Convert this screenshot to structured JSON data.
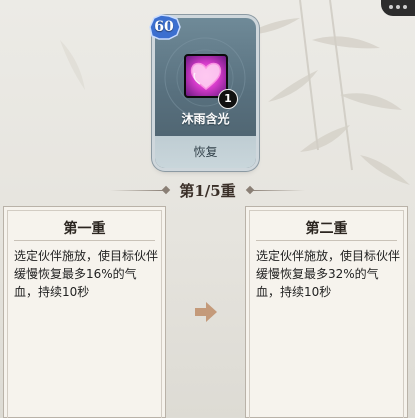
{
  "card": {
    "level": "60",
    "skill_count": "1",
    "skill_name": "沐雨含光",
    "skill_type": "恢复"
  },
  "tier": {
    "title": "第1/5重"
  },
  "current_tier": {
    "title": "第一重",
    "description": "选定伙伴施放，使目标伙伴缓慢恢复最多16%的气血，持续10秒"
  },
  "next_tier": {
    "title": "第二重",
    "description": "选定伙伴施放，使目标伙伴缓慢恢复最多32%的气血，持续10秒"
  },
  "icons": {
    "arrow": "right-arrow-icon",
    "skill": "pink-heart-icon"
  },
  "colors": {
    "background": "#e8e6e0",
    "card": "#5f7886",
    "level_badge": "#3c6fcf",
    "skill_icon": "#e04ed4",
    "arrow": "#c49a7a"
  }
}
